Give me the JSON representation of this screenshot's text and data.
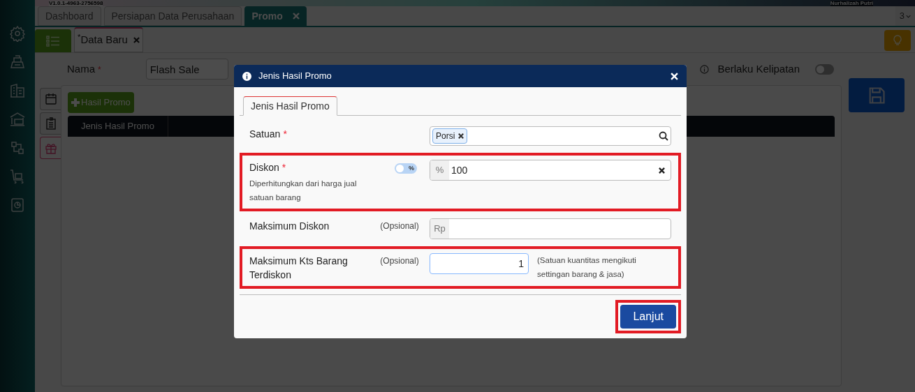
{
  "top_bar": {
    "version": "V1.0.1-4963-2756598",
    "user": "Nurhalizah Putri"
  },
  "tabs": [
    {
      "label": "Dashboard",
      "selected": false,
      "closable": false
    },
    {
      "label": "Persiapan Data Perusahaan",
      "selected": false,
      "closable": false
    },
    {
      "label": "Promo",
      "selected": true,
      "closable": true
    }
  ],
  "tab_count": "3",
  "subtabs": [
    {
      "label": "Data Baru",
      "marker": "*",
      "selected": true
    }
  ],
  "form": {
    "name_label": "Nama",
    "name_required": true,
    "name_value": "Flash Sale",
    "multiple_label": "Berlaku Kelipatan",
    "multiple_on": false
  },
  "side_tabs": [
    {
      "kind": "calendar",
      "selected": false
    },
    {
      "kind": "checklist",
      "selected": false
    },
    {
      "kind": "gift",
      "selected": true
    }
  ],
  "add_button": "Hasil Promo",
  "table": {
    "columns": [
      "Jenis Hasil Promo"
    ]
  },
  "dialog": {
    "title": "Jenis Hasil Promo",
    "tabs": [
      {
        "label": "Jenis Hasil Promo",
        "selected": true
      }
    ],
    "fields": [
      {
        "kind": "tags",
        "label": "Satuan",
        "required": true,
        "highlighted": false,
        "tags": [
          "Porsi"
        ]
      },
      {
        "kind": "percent",
        "label": "Diskon",
        "required": true,
        "highlighted": true,
        "hint": "Diperhitungkan dari harga jual satuan barang",
        "toggle_label": "%",
        "toggle_on": false,
        "prefix": "%",
        "value": "100"
      },
      {
        "kind": "currency",
        "label": "Maksimum Diskon",
        "optional": "(Opsional)",
        "required": false,
        "highlighted": false,
        "prefix": "Rp"
      },
      {
        "kind": "number",
        "label": "Maksimum Kts Barang Terdiskon",
        "optional": "(Opsional)",
        "required": false,
        "highlighted": true,
        "value": "1",
        "note": "(Satuan kuantitas mengikuti settingan barang & jasa)"
      }
    ],
    "button": {
      "label": "Lanjut",
      "highlighted": true
    }
  }
}
